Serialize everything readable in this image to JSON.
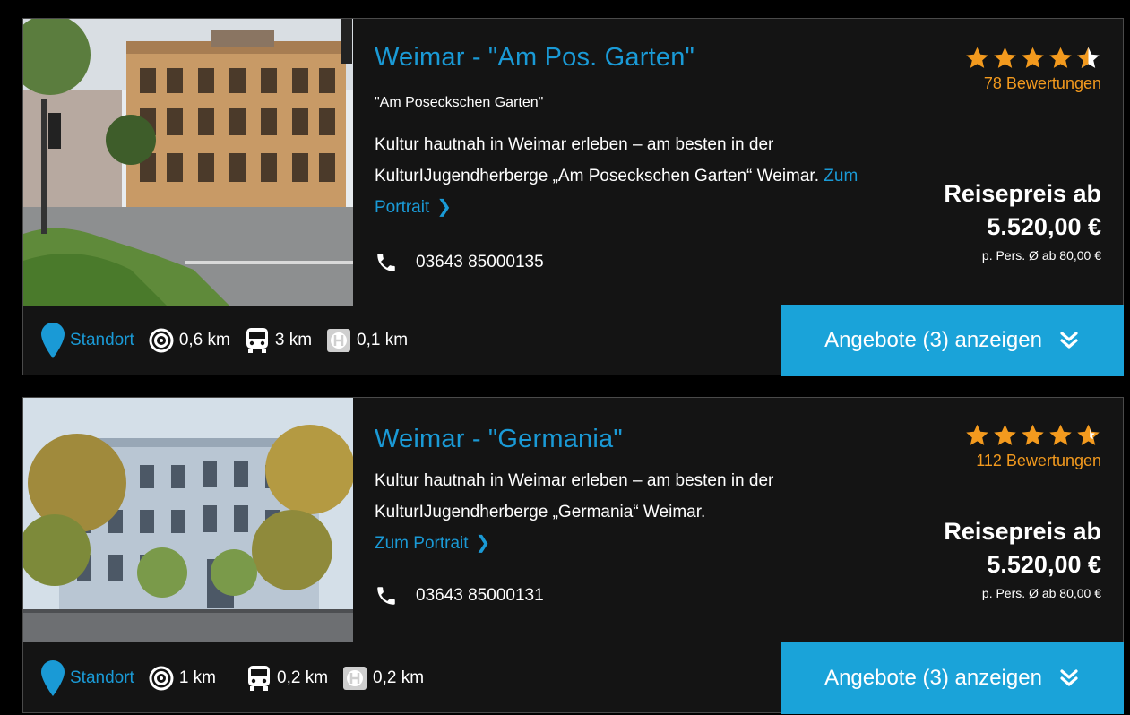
{
  "colors": {
    "accent_blue": "#1a9ad6",
    "button_blue": "#1aa3d9",
    "star_orange": "#f39a1e",
    "card_bg": "#141414"
  },
  "hostels": [
    {
      "title": "Weimar - \"Am Pos. Garten\"",
      "subtitle": "\"Am Poseckschen Garten\"",
      "description": "Kultur hautnah in Weimar erleben – am besten in der KulturIJugendherberge „Am Poseckschen Garten“ Weimar.",
      "portrait_link": "Zum Portrait",
      "phone": "03643 85000135",
      "rating": 4.5,
      "reviews": "78 Bewertungen",
      "price_label": "Reisepreis ab",
      "price_value": "5.520,00 €",
      "price_note": "p. Pers. Ø ab 80,00 €",
      "standort_label": "Standort",
      "dist_center": "0,6 km",
      "dist_bus": "3 km",
      "dist_stop": "0,1 km",
      "offers_button": "Angebote (3) anzeigen"
    },
    {
      "title": "Weimar - \"Germania\"",
      "subtitle": "",
      "description": "Kultur hautnah in Weimar erleben – am besten in der KulturIJugendherberge „Germania“ Weimar.",
      "portrait_link": "Zum Portrait",
      "phone": "03643 85000131",
      "rating": 4.5,
      "reviews": "112 Bewertungen",
      "price_label": "Reisepreis ab",
      "price_value": "5.520,00 €",
      "price_note": "p. Pers. Ø ab 80,00 €",
      "standort_label": "Standort",
      "dist_center": "1 km",
      "dist_bus": "0,2 km",
      "dist_stop": "0,2 km",
      "offers_button": "Angebote (3) anzeigen"
    }
  ]
}
